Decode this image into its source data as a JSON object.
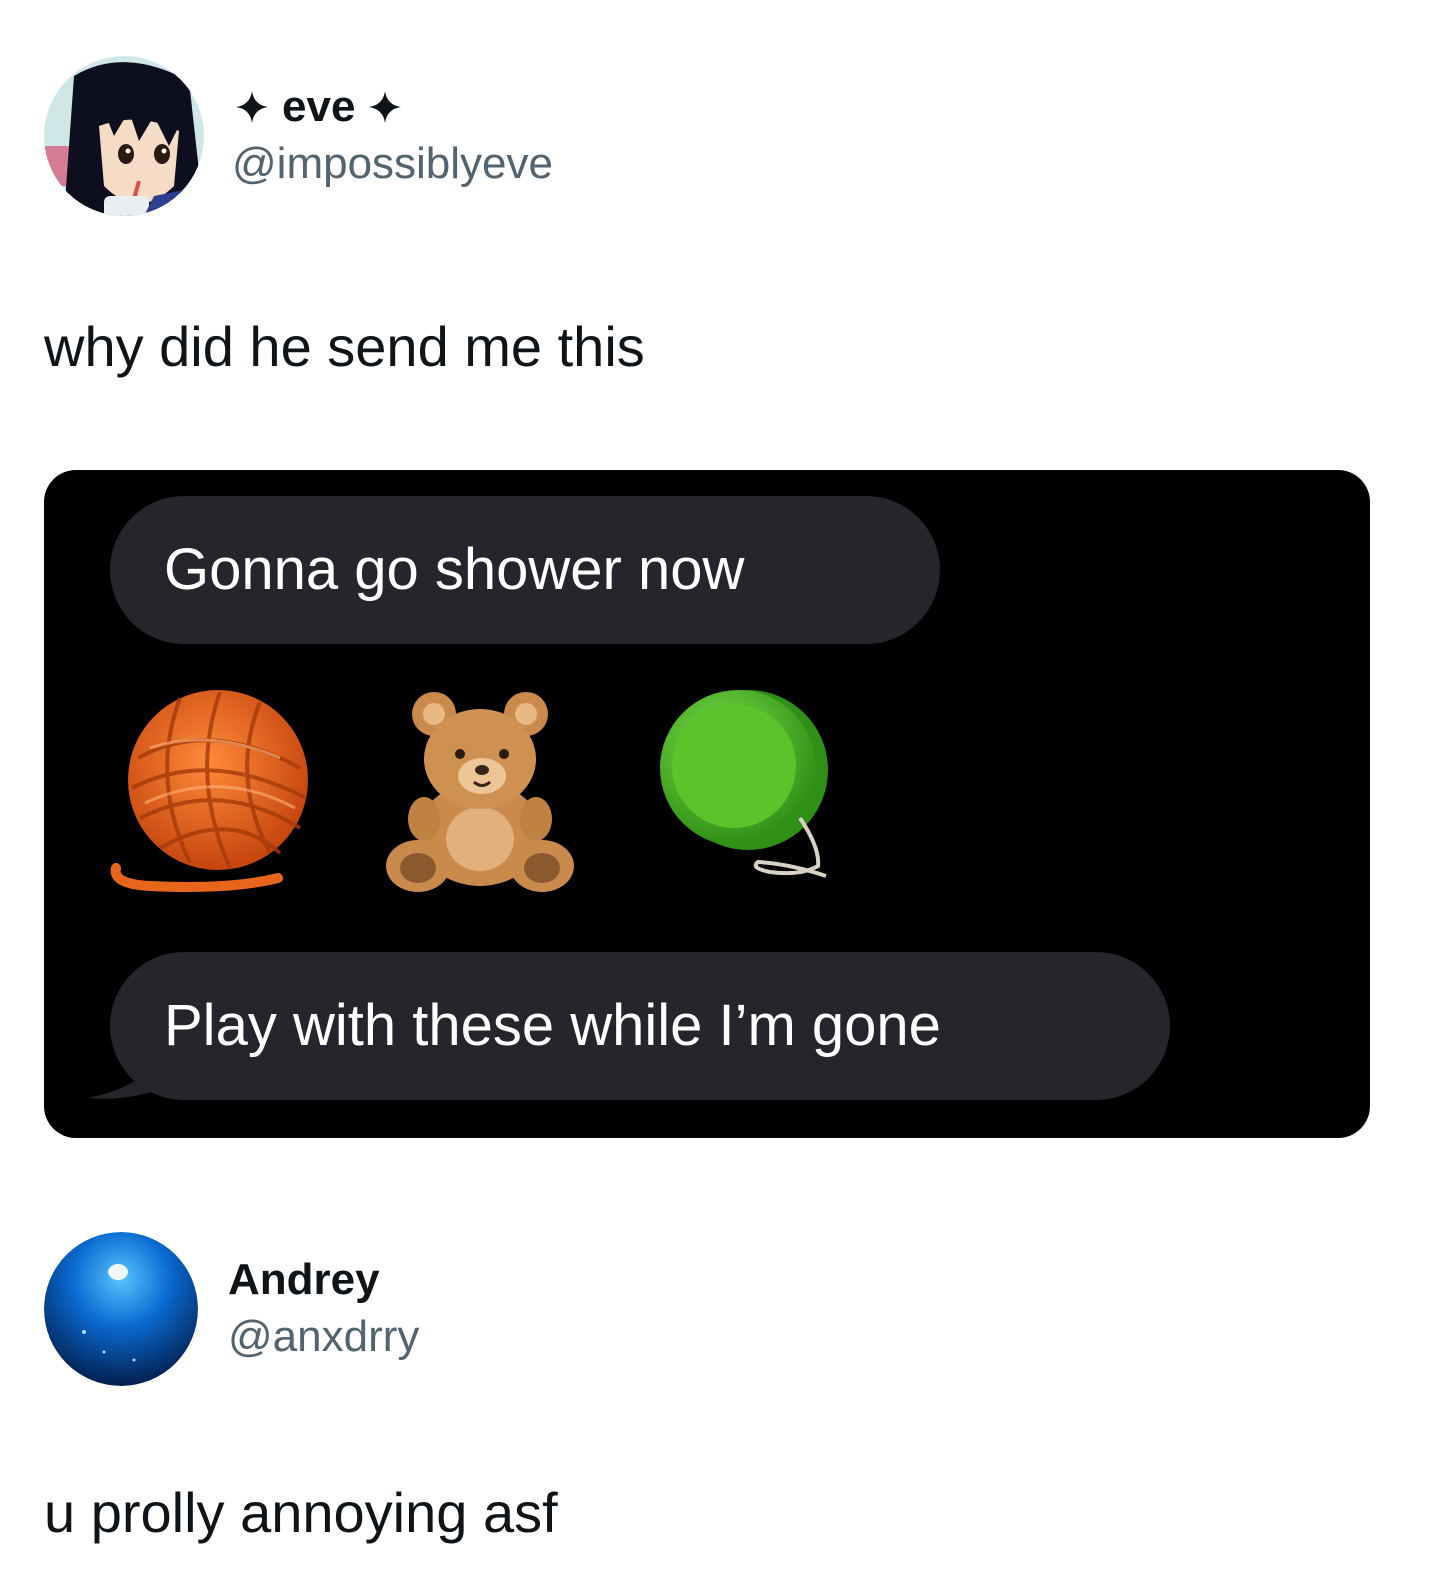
{
  "posts": [
    {
      "display_name": "eve",
      "handle": "@impossiblyeve",
      "text": "why did he send me this",
      "avatar_icon": "anime-girl-avatar-icon"
    },
    {
      "display_name": "Andrey",
      "handle": "@anxdrry",
      "text": "u prolly annoying asf",
      "avatar_icon": "blue-orb-avatar-icon"
    }
  ],
  "chat": {
    "messages": [
      {
        "text": "Gonna go shower now"
      },
      {
        "text": "Play with these while I’m gone"
      }
    ],
    "emojis": [
      "yarn-ball-emoji",
      "teddy-bear-emoji",
      "yo-yo-emoji"
    ]
  },
  "colors": {
    "text_primary": "#0f1419",
    "text_secondary": "#536471",
    "chat_background": "#000000",
    "bubble_background": "#26252b",
    "yarn": "#e8661c",
    "teddy": "#c98a4b",
    "yoyo": "#5bc42a"
  }
}
